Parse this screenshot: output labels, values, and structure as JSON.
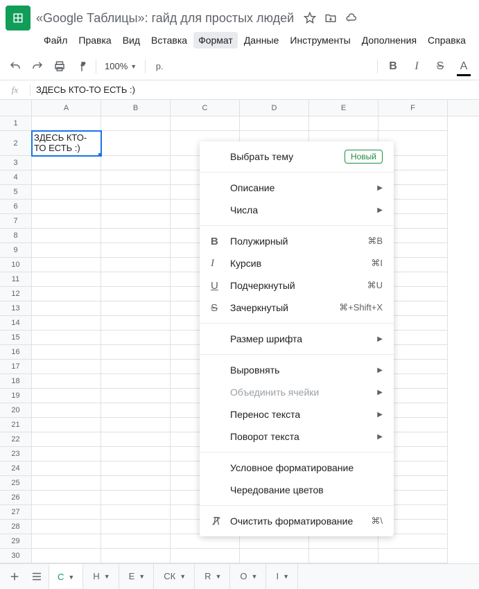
{
  "header": {
    "doc_title": "«Google Таблицы»: гайд для простых людей"
  },
  "menubar": [
    "Файл",
    "Правка",
    "Вид",
    "Вставка",
    "Формат",
    "Данные",
    "Инструменты",
    "Дополнения",
    "Справка"
  ],
  "toolbar": {
    "zoom": "100%",
    "currency_prefix": "р.",
    "bold": "B",
    "italic": "I",
    "strike": "S",
    "textcolor": "A"
  },
  "formula": {
    "fx": "fx",
    "value": "ЗДЕСЬ КТО-ТО ЕСТЬ :)"
  },
  "columns": [
    "A",
    "B",
    "C",
    "D",
    "E",
    "F"
  ],
  "rows": [
    "1",
    "2",
    "3",
    "4",
    "5",
    "6",
    "7",
    "8",
    "9",
    "10",
    "11",
    "12",
    "13",
    "14",
    "15",
    "16",
    "17",
    "18",
    "19",
    "20",
    "21",
    "22",
    "23",
    "24",
    "25",
    "26",
    "27",
    "28",
    "29",
    "30"
  ],
  "cell_a2": "ЗДЕСЬ КТО-ТО ЕСТЬ :)",
  "format_menu": {
    "theme": "Выбрать тему",
    "new_badge": "Новый",
    "description": "Описание",
    "numbers": "Числа",
    "bold": "Полужирный",
    "bold_sc": "⌘B",
    "italic": "Курсив",
    "italic_sc": "⌘I",
    "underline": "Подчеркнутый",
    "underline_sc": "⌘U",
    "strike": "Зачеркнутый",
    "strike_sc": "⌘+Shift+X",
    "fontsize": "Размер шрифта",
    "align": "Выровнять",
    "merge": "Объединить ячейки",
    "wrap": "Перенос текста",
    "rotate": "Поворот текста",
    "conditional": "Условное форматирование",
    "alternating": "Чередование цветов",
    "clear": "Очистить форматирование",
    "clear_sc": "⌘\\"
  },
  "sheet_tabs": [
    "С",
    "Н",
    "Е",
    "СК",
    "R",
    "О",
    "I"
  ]
}
